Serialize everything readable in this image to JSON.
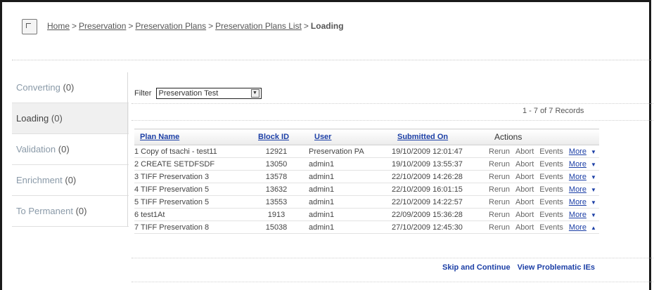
{
  "breadcrumb": {
    "items": [
      "Home",
      "Preservation",
      "Preservation Plans",
      "Preservation Plans List"
    ],
    "current": "Loading",
    "separator": ">"
  },
  "sidebar": {
    "items": [
      {
        "label": "Converting",
        "count": "(0)"
      },
      {
        "label": "Loading",
        "count": "(0)"
      },
      {
        "label": "Validation",
        "count": "(0)"
      },
      {
        "label": "Enrichment",
        "count": "(0)"
      },
      {
        "label": "To Permanent",
        "count": "(0)"
      }
    ]
  },
  "filter": {
    "label": "Filter",
    "selected": "Preservation Test"
  },
  "records": "1 - 7 of 7 Records",
  "table": {
    "headers": [
      "Plan Name",
      "Block ID",
      "User",
      "Submitted On",
      "Actions"
    ],
    "rows": [
      {
        "name": "1 Copy of tsachi - test11",
        "block_id": "12921",
        "user": "Preservation PA",
        "submitted": "19/10/2009 12:01:47"
      },
      {
        "name": "2 CREATE SETDFSDF",
        "block_id": "13050",
        "user": "admin1",
        "submitted": "19/10/2009 13:55:37"
      },
      {
        "name": "3 TIFF Preservation 3",
        "block_id": "13578",
        "user": "admin1",
        "submitted": "22/10/2009 14:26:28"
      },
      {
        "name": "4 TIFF Preservation 5",
        "block_id": "13632",
        "user": "admin1",
        "submitted": "22/10/2009 16:01:15"
      },
      {
        "name": "5 TIFF Preservation 5",
        "block_id": "13553",
        "user": "admin1",
        "submitted": "22/10/2009 14:22:57"
      },
      {
        "name": "6 test1At",
        "block_id": "1913",
        "user": "admin1",
        "submitted": "22/09/2009 15:36:28"
      },
      {
        "name": "7 TIFF Preservation 8",
        "block_id": "15038",
        "user": "admin1",
        "submitted": "27/10/2009 12:45:30"
      }
    ],
    "row_actions": {
      "rerun": "Rerun",
      "abort": "Abort",
      "events": "Events",
      "more": "More"
    }
  },
  "footer_actions": {
    "skip": "Skip and Continue",
    "view": "View Problematic IEs"
  },
  "icons": {
    "page": "plan-icon",
    "dropdown": "chevron-down-icon",
    "more_open": "caret-down-icon",
    "more_last": "caret-up-icon"
  },
  "colors": {
    "link": "#1c3fa6",
    "sidebar_text": "#8a9aa8",
    "active_bg": "#f0f0f0"
  }
}
